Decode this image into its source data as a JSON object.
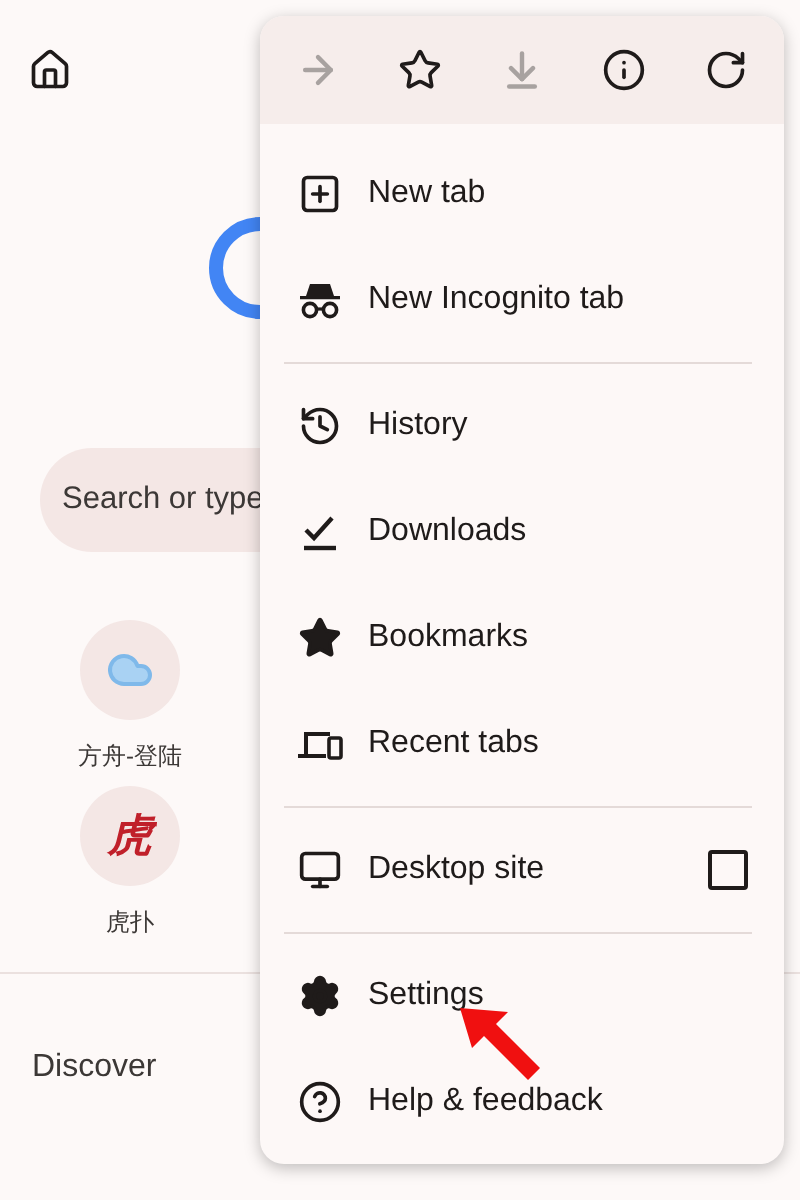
{
  "search": {
    "placeholder": "Search or type"
  },
  "shortcuts": [
    {
      "kind": "icon",
      "label": "方舟-登陆"
    },
    {
      "kind": "glyph",
      "glyph": "虎",
      "label": "虎扑"
    }
  ],
  "feed": {
    "title": "Discover"
  },
  "menu": {
    "toolbar": [
      {
        "disabled": true
      },
      {
        "disabled": false
      },
      {
        "disabled": true
      },
      {
        "disabled": false
      },
      {
        "disabled": false
      }
    ],
    "sections": [
      [
        {
          "kind": "plain",
          "label": "New tab"
        },
        {
          "kind": "plain",
          "label": "New Incognito tab"
        }
      ],
      [
        {
          "kind": "plain",
          "label": "History"
        },
        {
          "kind": "plain",
          "label": "Downloads"
        },
        {
          "kind": "plain",
          "label": "Bookmarks"
        },
        {
          "kind": "plain",
          "label": "Recent tabs"
        }
      ],
      [
        {
          "kind": "checkbox",
          "label": "Desktop site",
          "checked": false
        }
      ],
      [
        {
          "kind": "plain",
          "label": "Settings"
        },
        {
          "kind": "plain",
          "label": "Help & feedback"
        }
      ]
    ]
  }
}
